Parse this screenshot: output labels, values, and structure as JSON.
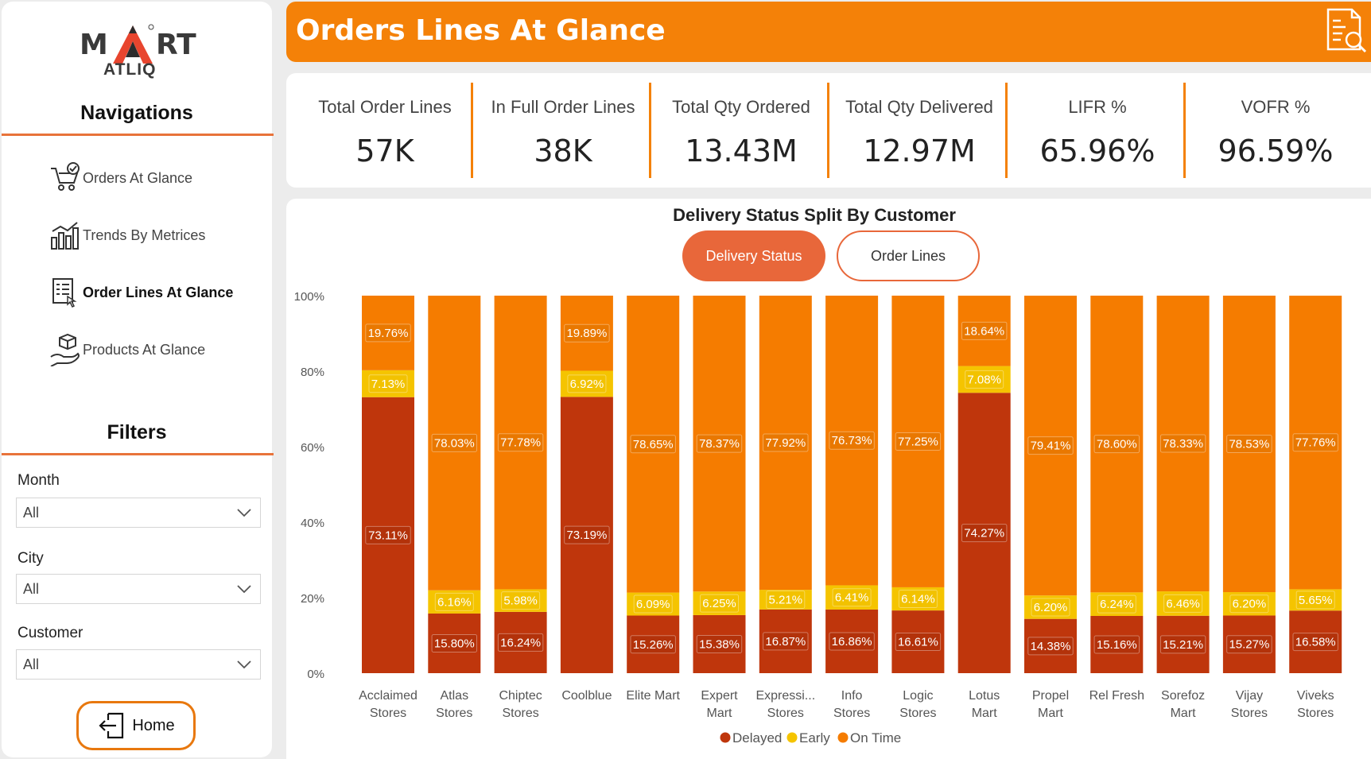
{
  "brand": {
    "logo_left": "M",
    "logo_right": "RT",
    "logo_sub": "ATLIQ"
  },
  "sidebar": {
    "nav_title": "Navigations",
    "nav_items": [
      {
        "label": "Orders At Glance",
        "icon": "cart-check-icon",
        "active": false
      },
      {
        "label": "Trends By Metrices",
        "icon": "bar-trend-icon",
        "active": false
      },
      {
        "label": "Order Lines At Glance",
        "icon": "checklist-icon",
        "active": true
      },
      {
        "label": "Products At Glance",
        "icon": "product-hand-icon",
        "active": false
      }
    ],
    "filters_title": "Filters",
    "filters": [
      {
        "label": "Month",
        "value": "All"
      },
      {
        "label": "City",
        "value": "All"
      },
      {
        "label": "Customer",
        "value": "All"
      }
    ],
    "home_label": "Home"
  },
  "header": {
    "title": "Orders Lines At Glance",
    "icon": "report-search-icon"
  },
  "kpis": [
    {
      "label": "Total Order Lines",
      "value": "57K"
    },
    {
      "label": "In Full Order Lines",
      "value": "38K"
    },
    {
      "label": "Total Qty Ordered",
      "value": "13.43M"
    },
    {
      "label": "Total Qty Delivered",
      "value": "12.97M"
    },
    {
      "label": "LIFR %",
      "value": "65.96%"
    },
    {
      "label": "VOFR %",
      "value": "96.59%"
    }
  ],
  "toggles": {
    "active": "Delivery Status",
    "inactive": "Order Lines"
  },
  "colors": {
    "delayed": "#bf360c",
    "early": "#f5c400",
    "on_time": "#f57c00",
    "accent": "#f48108"
  },
  "chart_data": {
    "type": "bar",
    "stacked": true,
    "title": "Delivery Status Split By Customer",
    "categories": [
      [
        "Acclaimed",
        "Stores"
      ],
      [
        "Atlas",
        "Stores"
      ],
      [
        "Chiptec",
        "Stores"
      ],
      [
        "Coolblue"
      ],
      [
        "Elite Mart"
      ],
      [
        "Expert",
        "Mart"
      ],
      [
        "Expressi...",
        "Stores"
      ],
      [
        "Info",
        "Stores"
      ],
      [
        "Logic",
        "Stores"
      ],
      [
        "Lotus",
        "Mart"
      ],
      [
        "Propel",
        "Mart"
      ],
      [
        "Rel Fresh"
      ],
      [
        "Sorefoz",
        "Mart"
      ],
      [
        "Vijay",
        "Stores"
      ],
      [
        "Viveks",
        "Stores"
      ]
    ],
    "series": [
      {
        "name": "Delayed",
        "values": [
          73.11,
          15.8,
          16.24,
          73.19,
          15.26,
          15.38,
          16.87,
          16.86,
          16.61,
          74.27,
          14.38,
          15.16,
          15.21,
          15.27,
          16.58
        ]
      },
      {
        "name": "Early",
        "values": [
          7.13,
          6.16,
          5.98,
          6.92,
          6.09,
          6.25,
          5.21,
          6.41,
          6.14,
          7.08,
          6.2,
          6.24,
          6.46,
          6.2,
          5.65
        ]
      },
      {
        "name": "On Time",
        "values": [
          19.76,
          78.03,
          77.78,
          19.89,
          78.65,
          78.37,
          77.92,
          76.73,
          77.25,
          18.64,
          79.41,
          78.6,
          78.33,
          78.53,
          77.76
        ]
      }
    ],
    "y_ticks": [
      "0%",
      "20%",
      "40%",
      "60%",
      "80%",
      "100%"
    ],
    "ylim": [
      0,
      100
    ],
    "legend_position": "bottom-center"
  }
}
